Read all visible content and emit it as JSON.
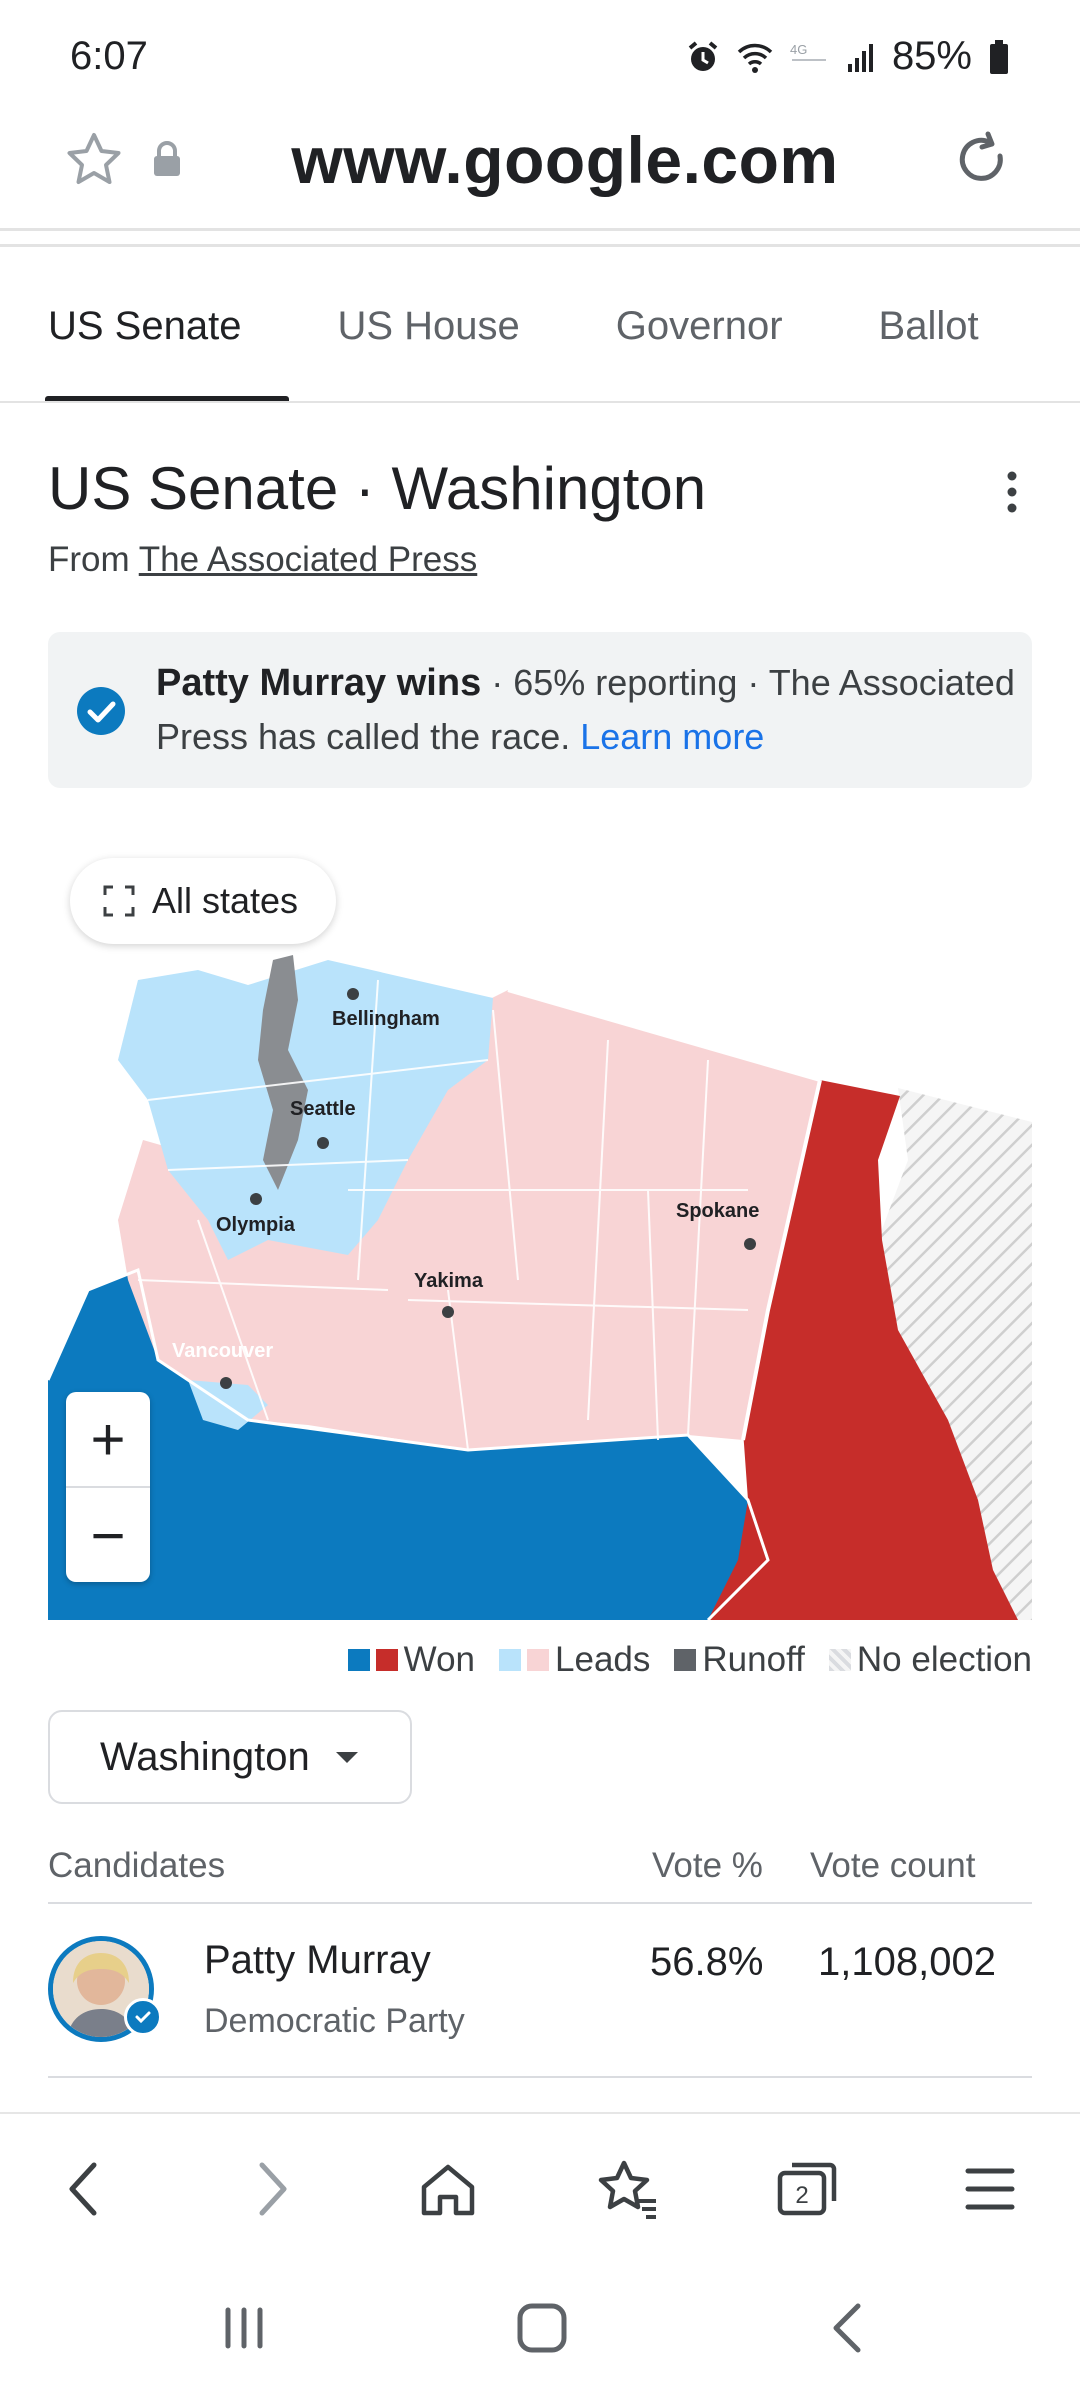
{
  "status_bar": {
    "time": "6:07",
    "battery": "85%"
  },
  "browser": {
    "url": "www.google.com"
  },
  "tabs": [
    {
      "label": "US Senate",
      "active": true
    },
    {
      "label": "US House",
      "active": false
    },
    {
      "label": "Governor",
      "active": false
    },
    {
      "label": "Ballot",
      "active": false
    }
  ],
  "header": {
    "title": "US Senate · Washington",
    "source_prefix": "From",
    "source_link": "The Associated Press"
  },
  "banner": {
    "headline": "Patty Murray wins",
    "detail": " · 65% reporting · The Associated Press has called the race.",
    "link": "Learn more"
  },
  "map": {
    "all_states_label": "All states",
    "cities": [
      "Bellingham",
      "Seattle",
      "Olympia",
      "Spokane",
      "Yakima",
      "Vancouver"
    ],
    "colors": {
      "dem_won": "#0c7abf",
      "rep_won": "#c62d2a",
      "dem_leads": "#b9e3fb",
      "rep_leads": "#f8d4d5",
      "runoff": "#5f6368"
    },
    "zoom_in": "+",
    "zoom_out": "−"
  },
  "legend": {
    "won": "Won",
    "leads": "Leads",
    "runoff": "Runoff",
    "no_election": "No election"
  },
  "region_select": {
    "value": "Washington"
  },
  "table": {
    "headers": {
      "candidates": "Candidates",
      "vote_pct": "Vote %",
      "vote_count": "Vote count"
    },
    "rows": [
      {
        "name": "Patty Murray",
        "party": "Democratic Party",
        "vote_pct": "56.8%",
        "vote_count": "1,108,002"
      }
    ]
  },
  "bottom_nav": {
    "tab_count": "2"
  }
}
